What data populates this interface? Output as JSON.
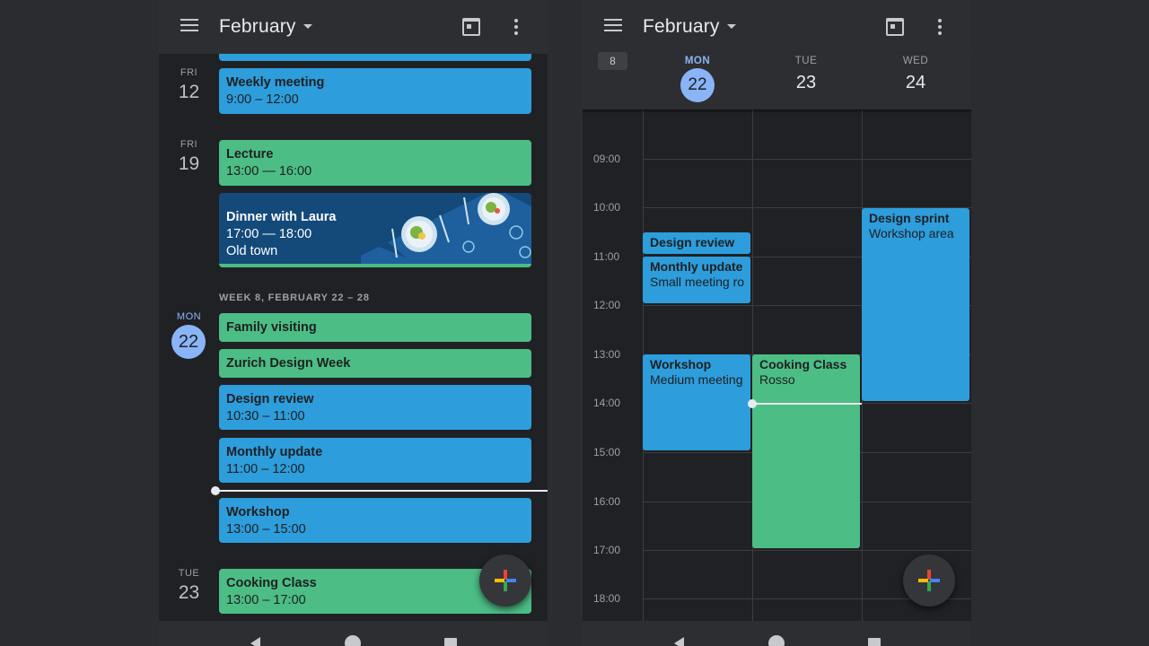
{
  "left": {
    "month": "February",
    "events": [
      {
        "title": "Weekly meeting",
        "time": "9:00 – 12:00"
      },
      {
        "title": "Lecture",
        "time": "13:00 — 16:00"
      },
      {
        "title": "Dinner with Laura",
        "time": "17:00 — 18:00",
        "location": "Old town"
      },
      {
        "title": "Family visiting"
      },
      {
        "title": "Zurich Design Week"
      },
      {
        "title": "Design review",
        "time": "10:30 – 11:00"
      },
      {
        "title": "Monthly update",
        "time": "11:00 – 12:00"
      },
      {
        "title": "Workshop",
        "time": "13:00 – 15:00"
      },
      {
        "title": "Cooking Class",
        "time": "13:00 – 17:00"
      }
    ],
    "days": [
      {
        "weekday": "FRI",
        "num": "12"
      },
      {
        "weekday": "FRI",
        "num": "19"
      },
      {
        "weekday": "MON",
        "num": "22"
      },
      {
        "weekday": "TUE",
        "num": "23"
      }
    ],
    "week_header": "WEEK 8, FEBRUARY 22 – 28"
  },
  "right": {
    "month": "February",
    "week_number": "8",
    "days": [
      {
        "weekday": "MON",
        "num": "22"
      },
      {
        "weekday": "TUE",
        "num": "23"
      },
      {
        "weekday": "WED",
        "num": "24"
      }
    ],
    "hours": [
      "09:00",
      "10:00",
      "11:00",
      "12:00",
      "13:00",
      "14:00",
      "15:00",
      "16:00",
      "17:00",
      "18:00"
    ],
    "events": [
      {
        "title": "Design review",
        "location": ""
      },
      {
        "title": "Monthly update",
        "location": "Small meeting ro"
      },
      {
        "title": "Workshop",
        "location": "Medium meeting"
      },
      {
        "title": "Cooking Class",
        "location": "Rosso"
      },
      {
        "title": "Design sprint",
        "location": "Workshop area"
      }
    ]
  },
  "colors": {
    "event_blue": "#2d9ddc",
    "event_green": "#4cbd85",
    "today_accent": "#8ab4f8",
    "background": "#202124"
  },
  "icons": [
    "menu-icon",
    "chevron-down-icon",
    "today-calendar-icon",
    "more-vert-icon",
    "add-plus-icon",
    "nav-back-icon",
    "nav-home-icon",
    "nav-recents-icon"
  ]
}
